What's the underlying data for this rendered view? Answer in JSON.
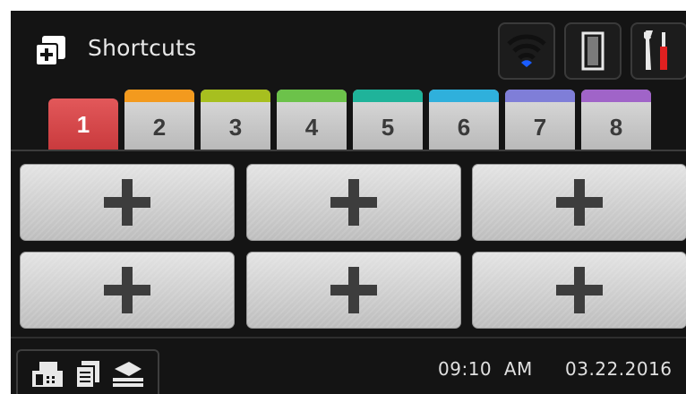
{
  "header": {
    "title": "Shortcuts",
    "app_icon": "add-shortcut-icon",
    "status_icons": [
      "wifi-icon",
      "toner-icon",
      "settings-tools-icon"
    ]
  },
  "tabs": [
    {
      "label": "1",
      "color": "#d94a4c",
      "active": true
    },
    {
      "label": "2",
      "color": "#f39a1e",
      "active": false
    },
    {
      "label": "3",
      "color": "#a7bf1f",
      "active": false
    },
    {
      "label": "4",
      "color": "#6cc24a",
      "active": false
    },
    {
      "label": "5",
      "color": "#1fb39a",
      "active": false
    },
    {
      "label": "6",
      "color": "#2fb0dc",
      "active": false
    },
    {
      "label": "7",
      "color": "#7f7ed8",
      "active": false
    },
    {
      "label": "8",
      "color": "#a064c8",
      "active": false
    }
  ],
  "shortcut_slots": [
    "add-shortcut",
    "add-shortcut",
    "add-shortcut",
    "add-shortcut",
    "add-shortcut",
    "add-shortcut"
  ],
  "footer": {
    "mode_icons": [
      "fax-icon",
      "copy-icon",
      "scan-icon"
    ],
    "time": "09:10",
    "ampm": "AM",
    "date": "03.22.2016"
  },
  "colors": {
    "background": "#141414",
    "wifi_accent": "#1a5cff",
    "tool_accent": "#e02020"
  }
}
